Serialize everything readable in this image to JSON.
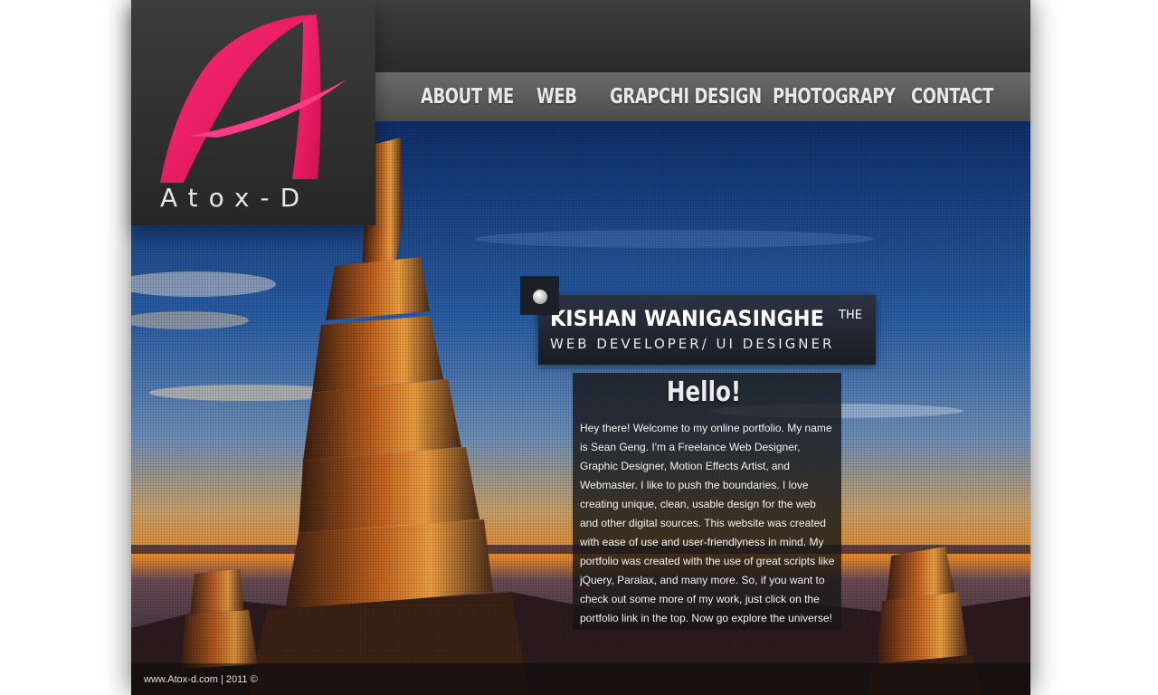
{
  "brand": {
    "logo_text": "Atox-D",
    "logo_color": "#e8175d"
  },
  "nav": {
    "items": [
      {
        "label": "ABOUT ME"
      },
      {
        "label": "WEB"
      },
      {
        "label": "GRAPCHI DESIGN"
      },
      {
        "label": "PHOTOGRAPY"
      },
      {
        "label": "CONTACT"
      }
    ]
  },
  "intro": {
    "name": "KISHAN WANIGASINGHE",
    "the": "THE",
    "role": "WEB DEVELOPER/ UI DESIGNER"
  },
  "hello": {
    "title": "Hello!",
    "body": "Hey there! Welcome to my online portfolio. My name is Sean Geng. I'm a Freelance Web Designer, Graphic Designer, Motion Effects Artist, and Webmaster. I like to push the boundaries. I love creating unique, clean, usable design for the web and other digital sources. This website was created with ease of use and user-friendlyness in mind. My portfolio was created with the use of great scripts like jQuery, Paralax, and many more. So, if you want to check out some more of my work, just click on the portfolio link in the top. Now go explore the universe!"
  },
  "footer": {
    "text": "www.Atox-d.com | 2011 ©"
  }
}
